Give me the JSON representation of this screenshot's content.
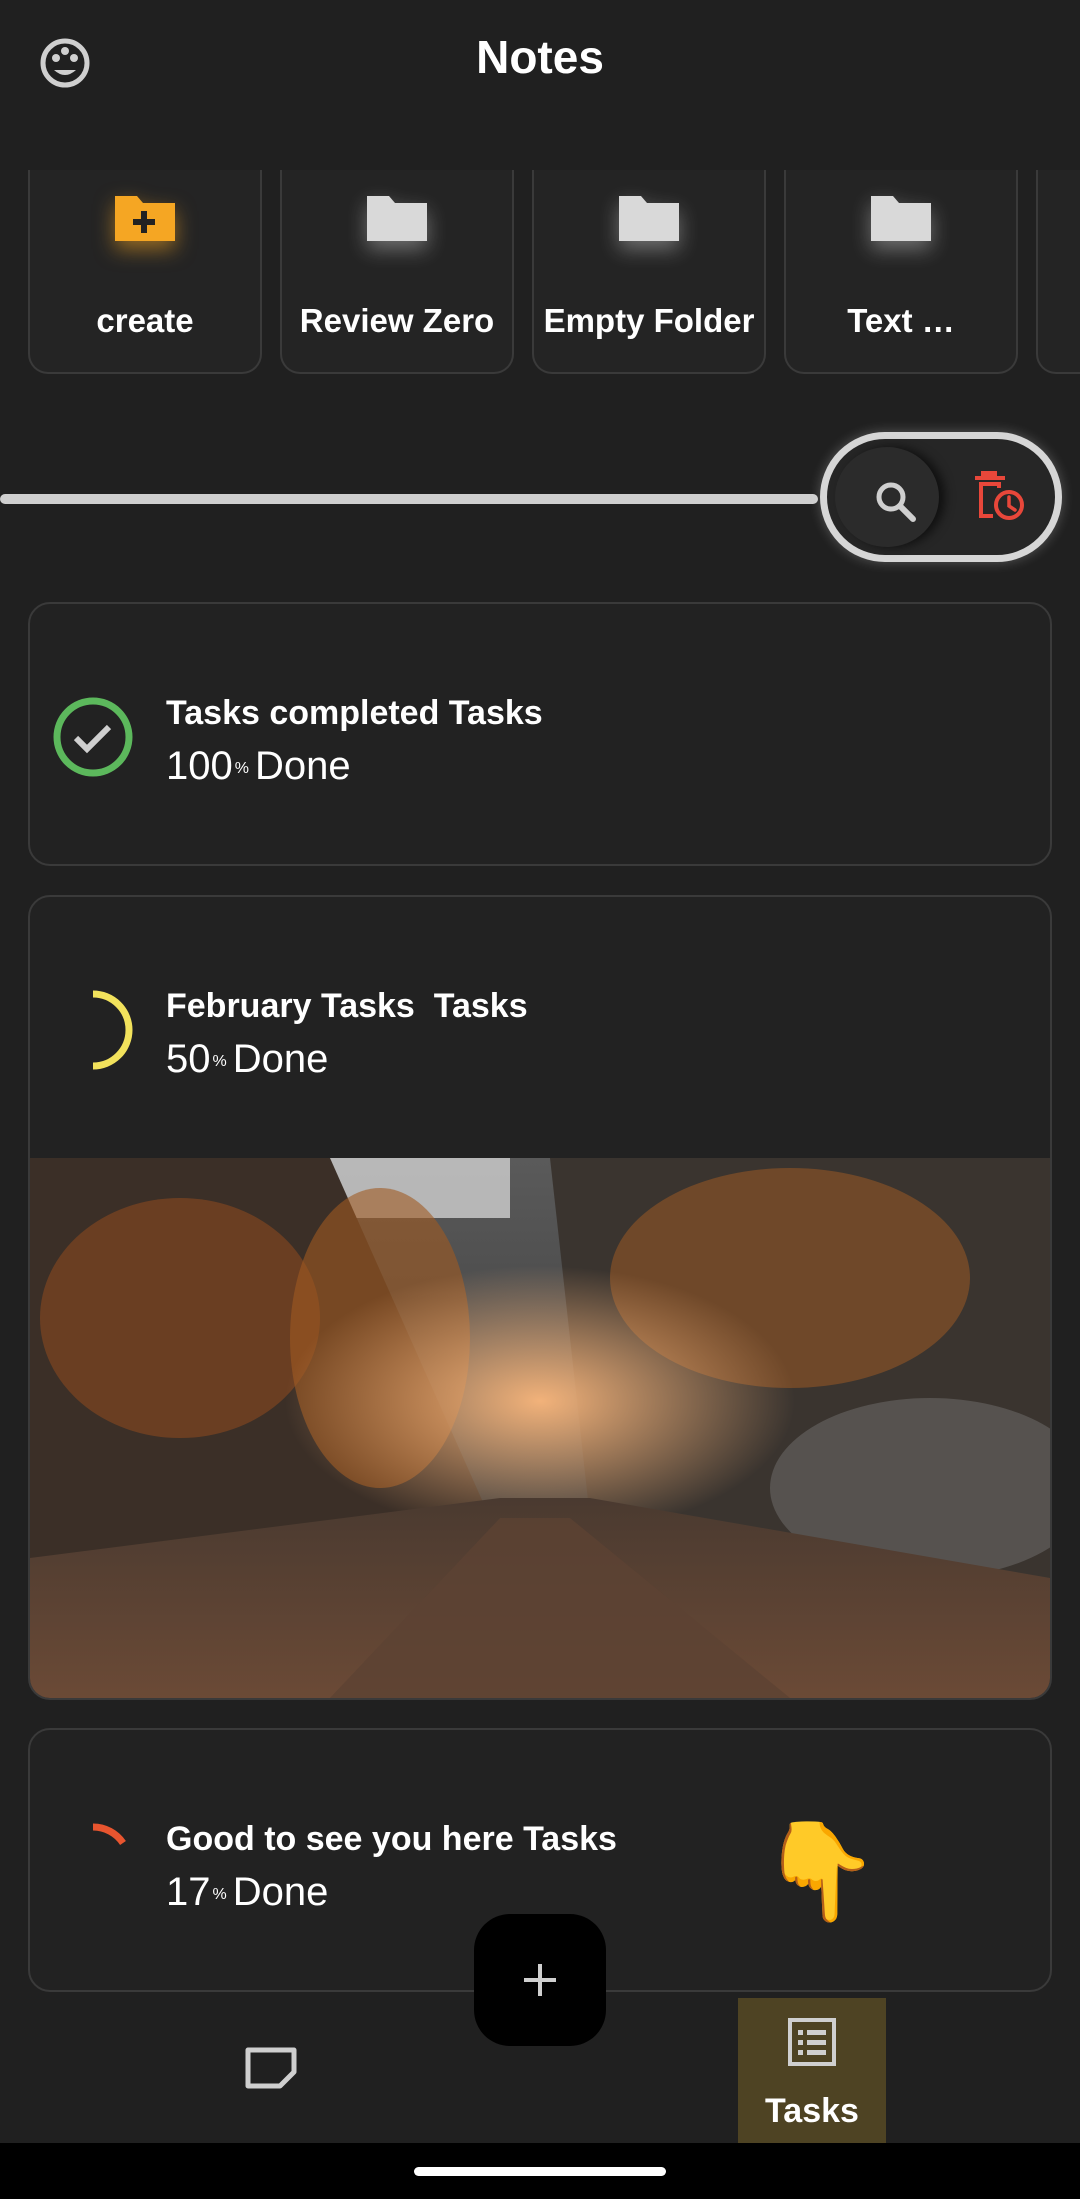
{
  "header": {
    "title": "Notes",
    "palette_icon": "palette-icon"
  },
  "folders": [
    {
      "label": "create",
      "icon": "folder-plus-icon",
      "color": "#F5A623"
    },
    {
      "label": "Review Zero",
      "icon": "folder-icon",
      "color": "#D9D9D9"
    },
    {
      "label": "Empty Folder",
      "icon": "folder-icon",
      "color": "#D9D9D9"
    },
    {
      "label": "Text …",
      "icon": "folder-icon",
      "color": "#D9D9D9"
    }
  ],
  "search": {
    "icon": "search-icon",
    "trash_icon": "trash-clock-icon",
    "trash_color": "#E8473A"
  },
  "tasks": [
    {
      "title": "Tasks completed Tasks",
      "percent": "100",
      "suffix": "%",
      "done_label": "Done",
      "progress": 1.0,
      "color": "#5CB85C",
      "status_icon": "check-icon"
    },
    {
      "title": "February Tasks  Tasks",
      "percent": "50",
      "suffix": "%",
      "done_label": "Done",
      "progress": 0.5,
      "color": "#F2E25C"
    },
    {
      "title": "Good to see you here Tasks",
      "percent": "17",
      "suffix": "%",
      "done_label": "Done",
      "progress": 0.17,
      "color": "#E8552F"
    }
  ],
  "fab": {
    "icon": "plus-icon"
  },
  "bottom_nav": {
    "notes_icon": "note-icon",
    "tasks_icon": "list-icon",
    "tasks_label": "Tasks",
    "tasks_active_color": "#4E4323"
  },
  "hand_emoji": "👇"
}
